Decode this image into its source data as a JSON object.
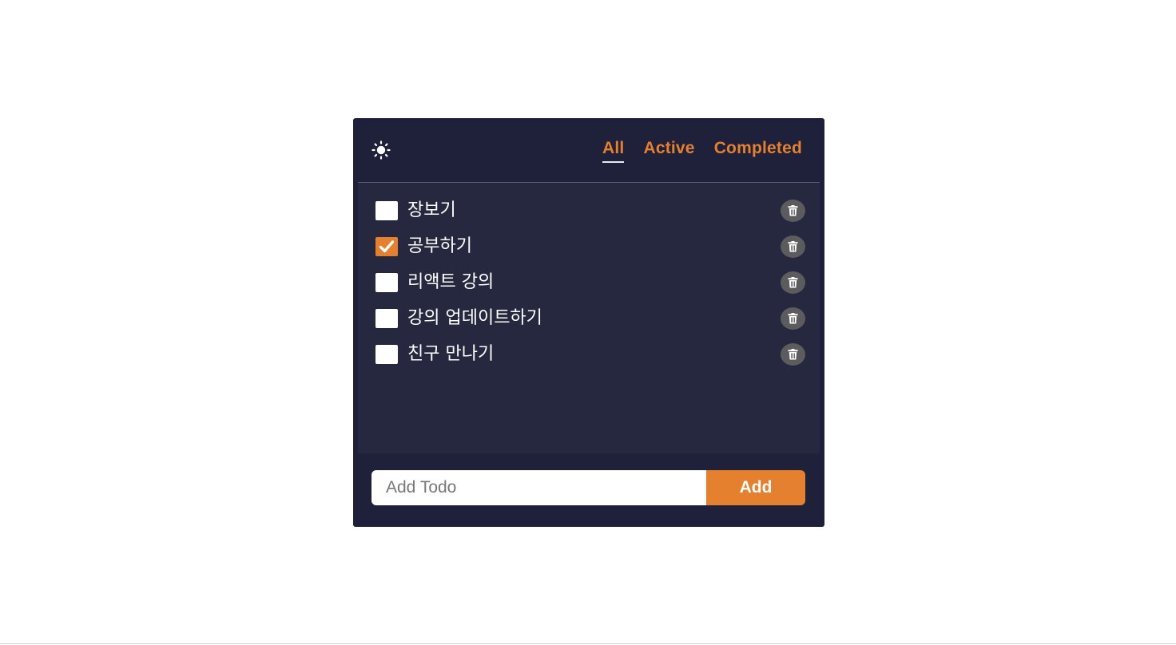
{
  "header": {
    "theme_icon": "sun-icon",
    "filters": [
      {
        "label": "All",
        "selected": true
      },
      {
        "label": "Active",
        "selected": false
      },
      {
        "label": "Completed",
        "selected": false
      }
    ]
  },
  "todos": [
    {
      "text": "장보기",
      "completed": false
    },
    {
      "text": "공부하기",
      "completed": true
    },
    {
      "text": "리액트 강의",
      "completed": false
    },
    {
      "text": "강의 업데이트하기",
      "completed": false
    },
    {
      "text": "친구 만나기",
      "completed": false
    }
  ],
  "footer": {
    "input_placeholder": "Add Todo",
    "input_value": "",
    "add_label": "Add"
  },
  "colors": {
    "accent": "#e5802f",
    "frame": "#1e1f3b",
    "header_bg": "#1f203a",
    "list_bg": "#262840",
    "delete_button": "#5c5c5e"
  },
  "icons": {
    "delete": "trash-icon",
    "check": "checkmark-icon"
  }
}
